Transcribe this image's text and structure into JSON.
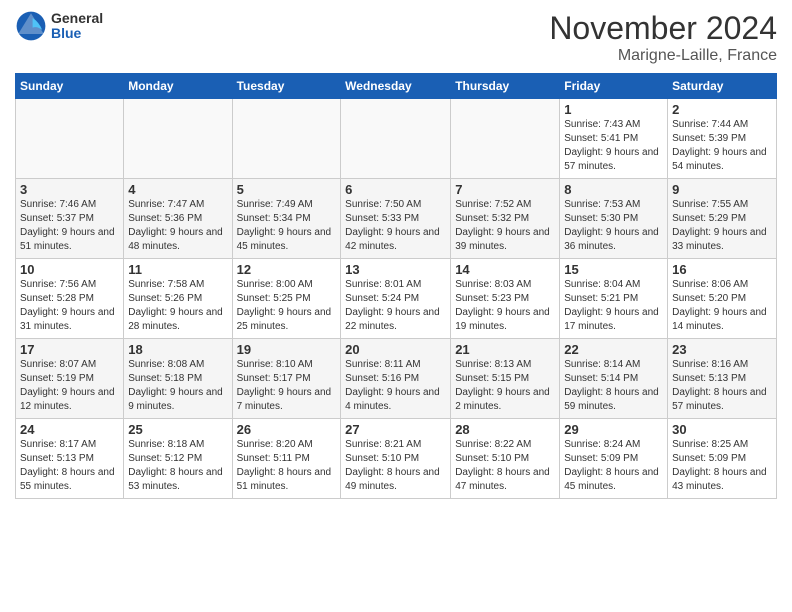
{
  "logo": {
    "general": "General",
    "blue": "Blue"
  },
  "title": "November 2024",
  "location": "Marigne-Laille, France",
  "days_header": [
    "Sunday",
    "Monday",
    "Tuesday",
    "Wednesday",
    "Thursday",
    "Friday",
    "Saturday"
  ],
  "weeks": [
    [
      {
        "day": "",
        "info": ""
      },
      {
        "day": "",
        "info": ""
      },
      {
        "day": "",
        "info": ""
      },
      {
        "day": "",
        "info": ""
      },
      {
        "day": "",
        "info": ""
      },
      {
        "day": "1",
        "info": "Sunrise: 7:43 AM\nSunset: 5:41 PM\nDaylight: 9 hours and 57 minutes."
      },
      {
        "day": "2",
        "info": "Sunrise: 7:44 AM\nSunset: 5:39 PM\nDaylight: 9 hours and 54 minutes."
      }
    ],
    [
      {
        "day": "3",
        "info": "Sunrise: 7:46 AM\nSunset: 5:37 PM\nDaylight: 9 hours and 51 minutes."
      },
      {
        "day": "4",
        "info": "Sunrise: 7:47 AM\nSunset: 5:36 PM\nDaylight: 9 hours and 48 minutes."
      },
      {
        "day": "5",
        "info": "Sunrise: 7:49 AM\nSunset: 5:34 PM\nDaylight: 9 hours and 45 minutes."
      },
      {
        "day": "6",
        "info": "Sunrise: 7:50 AM\nSunset: 5:33 PM\nDaylight: 9 hours and 42 minutes."
      },
      {
        "day": "7",
        "info": "Sunrise: 7:52 AM\nSunset: 5:32 PM\nDaylight: 9 hours and 39 minutes."
      },
      {
        "day": "8",
        "info": "Sunrise: 7:53 AM\nSunset: 5:30 PM\nDaylight: 9 hours and 36 minutes."
      },
      {
        "day": "9",
        "info": "Sunrise: 7:55 AM\nSunset: 5:29 PM\nDaylight: 9 hours and 33 minutes."
      }
    ],
    [
      {
        "day": "10",
        "info": "Sunrise: 7:56 AM\nSunset: 5:28 PM\nDaylight: 9 hours and 31 minutes."
      },
      {
        "day": "11",
        "info": "Sunrise: 7:58 AM\nSunset: 5:26 PM\nDaylight: 9 hours and 28 minutes."
      },
      {
        "day": "12",
        "info": "Sunrise: 8:00 AM\nSunset: 5:25 PM\nDaylight: 9 hours and 25 minutes."
      },
      {
        "day": "13",
        "info": "Sunrise: 8:01 AM\nSunset: 5:24 PM\nDaylight: 9 hours and 22 minutes."
      },
      {
        "day": "14",
        "info": "Sunrise: 8:03 AM\nSunset: 5:23 PM\nDaylight: 9 hours and 19 minutes."
      },
      {
        "day": "15",
        "info": "Sunrise: 8:04 AM\nSunset: 5:21 PM\nDaylight: 9 hours and 17 minutes."
      },
      {
        "day": "16",
        "info": "Sunrise: 8:06 AM\nSunset: 5:20 PM\nDaylight: 9 hours and 14 minutes."
      }
    ],
    [
      {
        "day": "17",
        "info": "Sunrise: 8:07 AM\nSunset: 5:19 PM\nDaylight: 9 hours and 12 minutes."
      },
      {
        "day": "18",
        "info": "Sunrise: 8:08 AM\nSunset: 5:18 PM\nDaylight: 9 hours and 9 minutes."
      },
      {
        "day": "19",
        "info": "Sunrise: 8:10 AM\nSunset: 5:17 PM\nDaylight: 9 hours and 7 minutes."
      },
      {
        "day": "20",
        "info": "Sunrise: 8:11 AM\nSunset: 5:16 PM\nDaylight: 9 hours and 4 minutes."
      },
      {
        "day": "21",
        "info": "Sunrise: 8:13 AM\nSunset: 5:15 PM\nDaylight: 9 hours and 2 minutes."
      },
      {
        "day": "22",
        "info": "Sunrise: 8:14 AM\nSunset: 5:14 PM\nDaylight: 8 hours and 59 minutes."
      },
      {
        "day": "23",
        "info": "Sunrise: 8:16 AM\nSunset: 5:13 PM\nDaylight: 8 hours and 57 minutes."
      }
    ],
    [
      {
        "day": "24",
        "info": "Sunrise: 8:17 AM\nSunset: 5:13 PM\nDaylight: 8 hours and 55 minutes."
      },
      {
        "day": "25",
        "info": "Sunrise: 8:18 AM\nSunset: 5:12 PM\nDaylight: 8 hours and 53 minutes."
      },
      {
        "day": "26",
        "info": "Sunrise: 8:20 AM\nSunset: 5:11 PM\nDaylight: 8 hours and 51 minutes."
      },
      {
        "day": "27",
        "info": "Sunrise: 8:21 AM\nSunset: 5:10 PM\nDaylight: 8 hours and 49 minutes."
      },
      {
        "day": "28",
        "info": "Sunrise: 8:22 AM\nSunset: 5:10 PM\nDaylight: 8 hours and 47 minutes."
      },
      {
        "day": "29",
        "info": "Sunrise: 8:24 AM\nSunset: 5:09 PM\nDaylight: 8 hours and 45 minutes."
      },
      {
        "day": "30",
        "info": "Sunrise: 8:25 AM\nSunset: 5:09 PM\nDaylight: 8 hours and 43 minutes."
      }
    ]
  ]
}
